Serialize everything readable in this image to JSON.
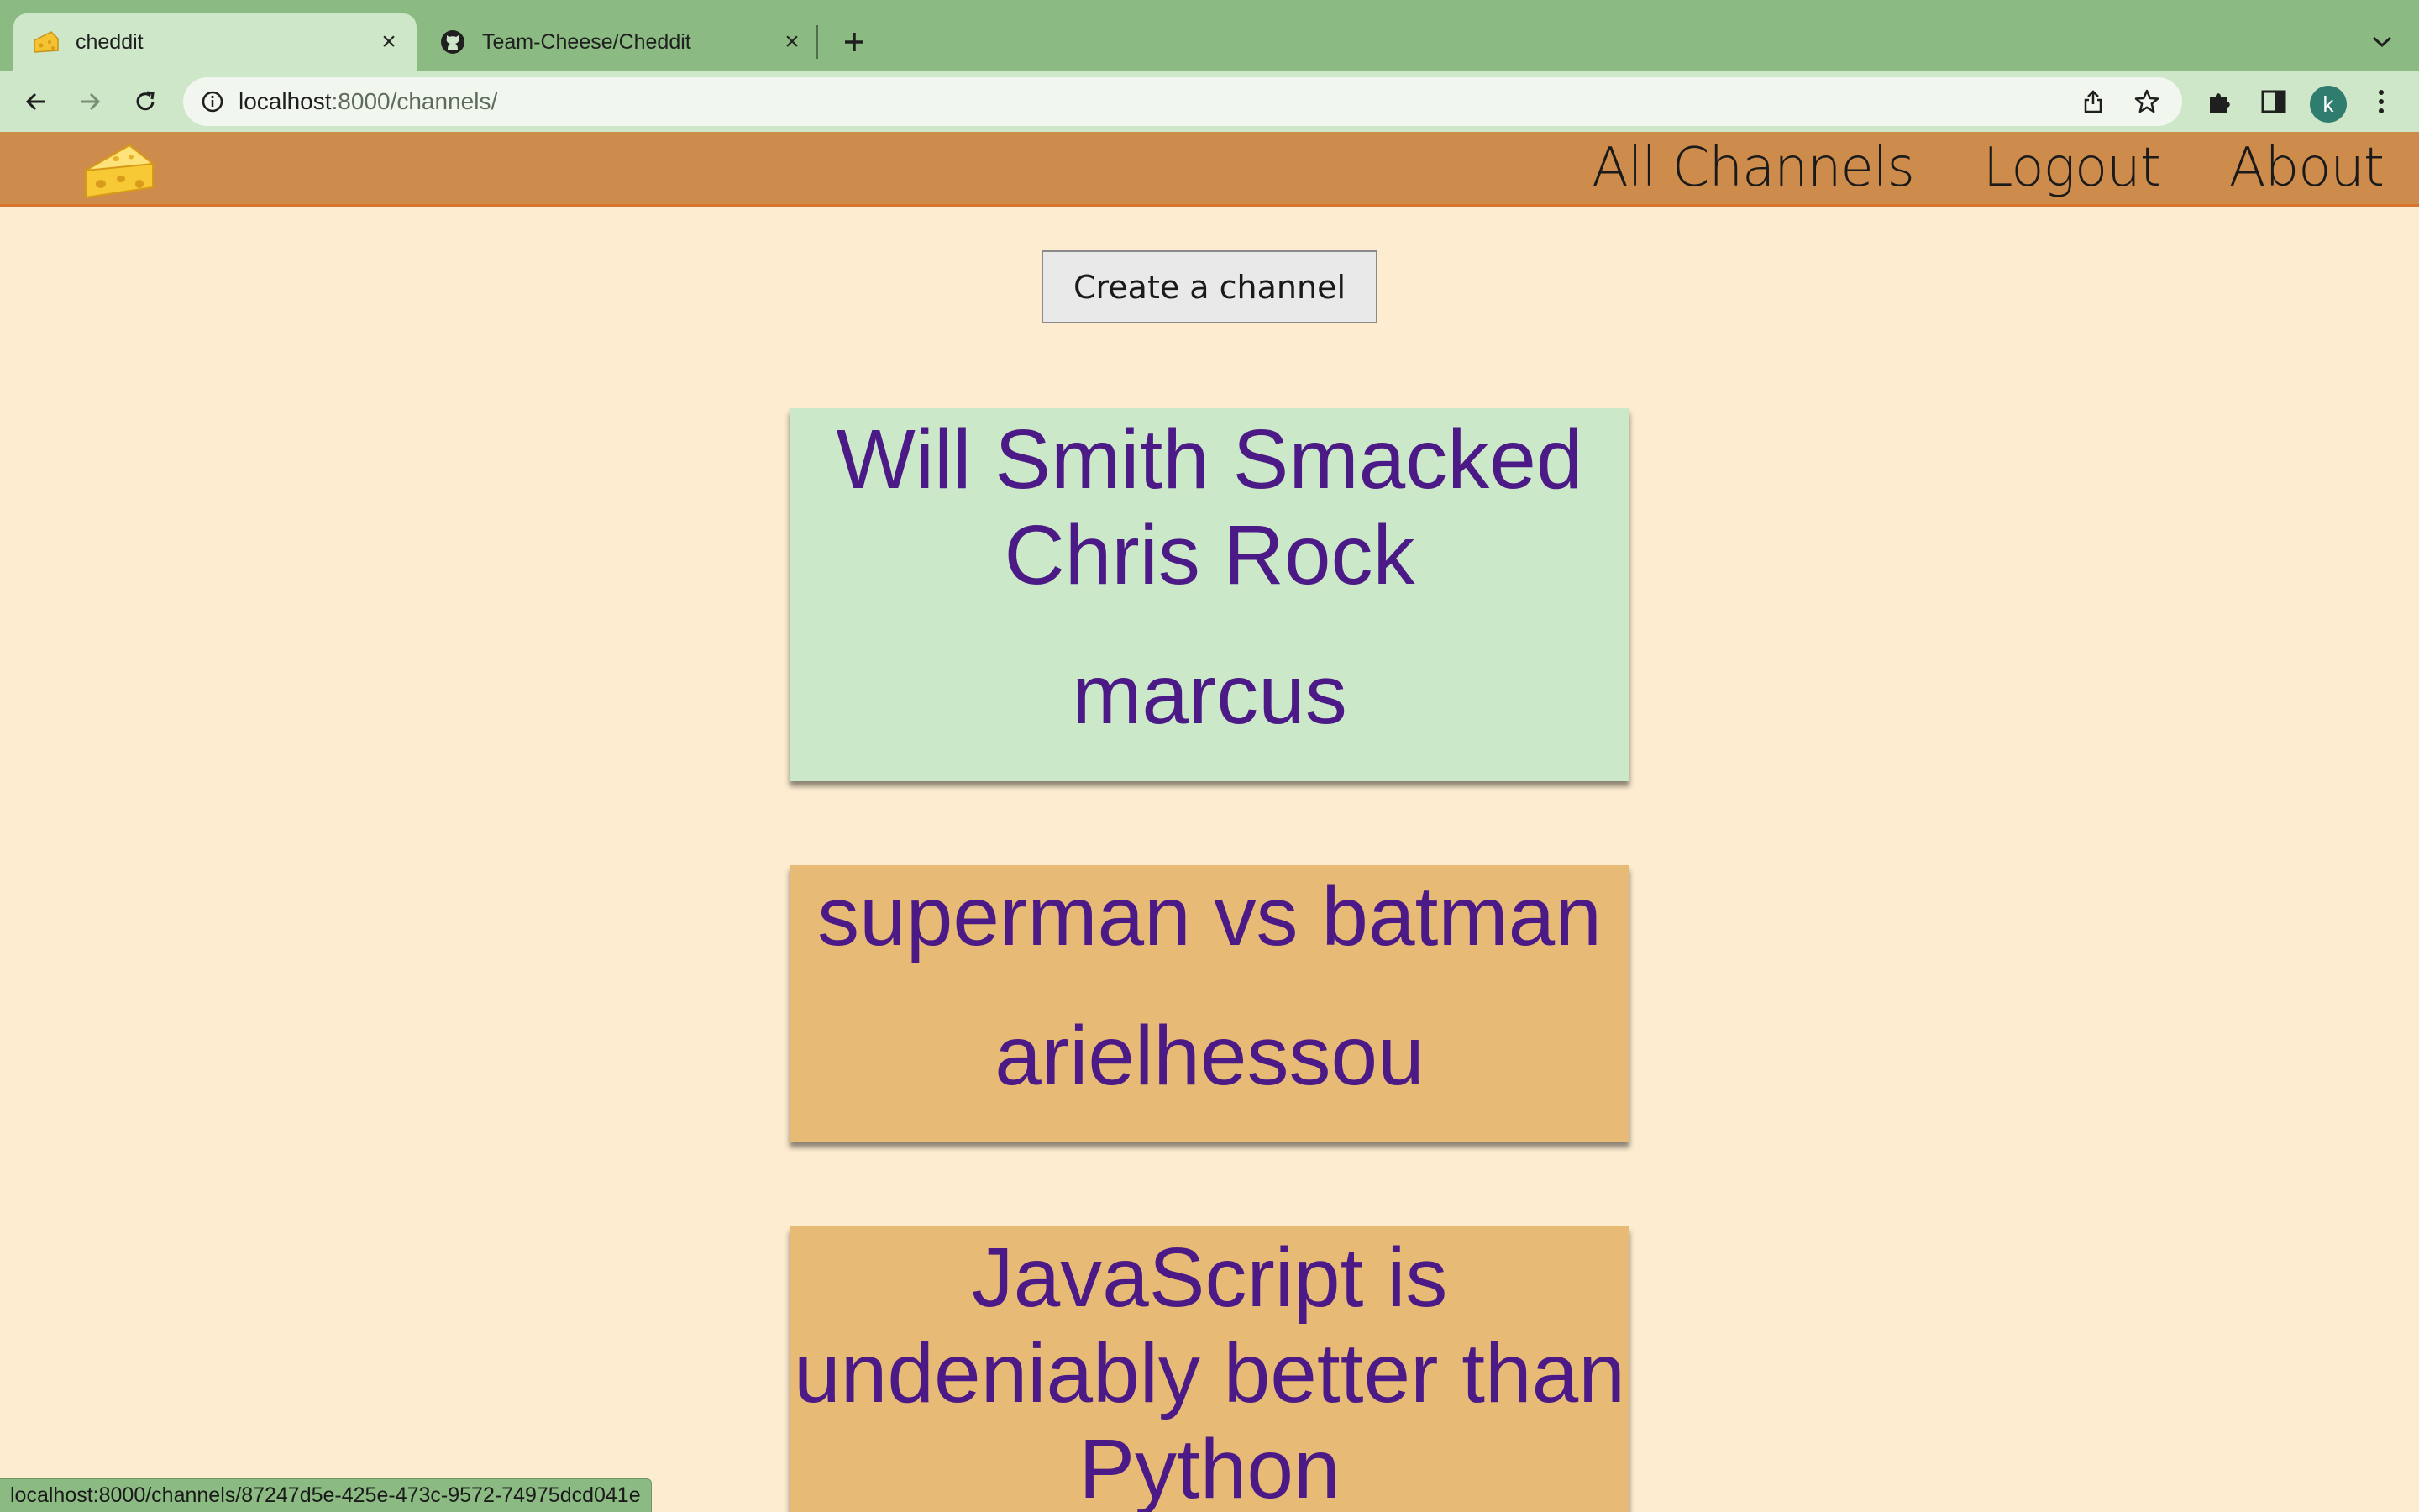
{
  "browser": {
    "tabs": [
      {
        "title": "cheddit",
        "icon": "cheese-icon",
        "active": true
      },
      {
        "title": "Team-Cheese/Cheddit",
        "icon": "github-icon",
        "active": false
      }
    ],
    "url_host": "localhost",
    "url_path": ":8000/channels/",
    "profile_initial": "k",
    "status_url": "localhost:8000/channels/87247d5e-425e-473c-9572-74975dcd041e",
    "colors": {
      "tabstrip": "#8bba82",
      "toolbar": "#cde7c8"
    }
  },
  "site": {
    "logo_icon": "cheese-icon",
    "nav": {
      "all_channels": "All Channels",
      "logout": "Logout",
      "about": "About"
    },
    "colors": {
      "header": "#cd8c4c",
      "page": "#fdecd0",
      "card_text": "#4c1a86"
    }
  },
  "main": {
    "create_label": "Create a channel",
    "channels": [
      {
        "title": "Will Smith Smacked Chris Rock",
        "author": "marcus",
        "color": "#cbe8c8"
      },
      {
        "title": "superman vs batman",
        "author": "arielhessou",
        "color": "#e7bb75"
      },
      {
        "title": "JavaScript is undeniably better than Python",
        "author": "",
        "color": "#e7bb75"
      }
    ]
  }
}
